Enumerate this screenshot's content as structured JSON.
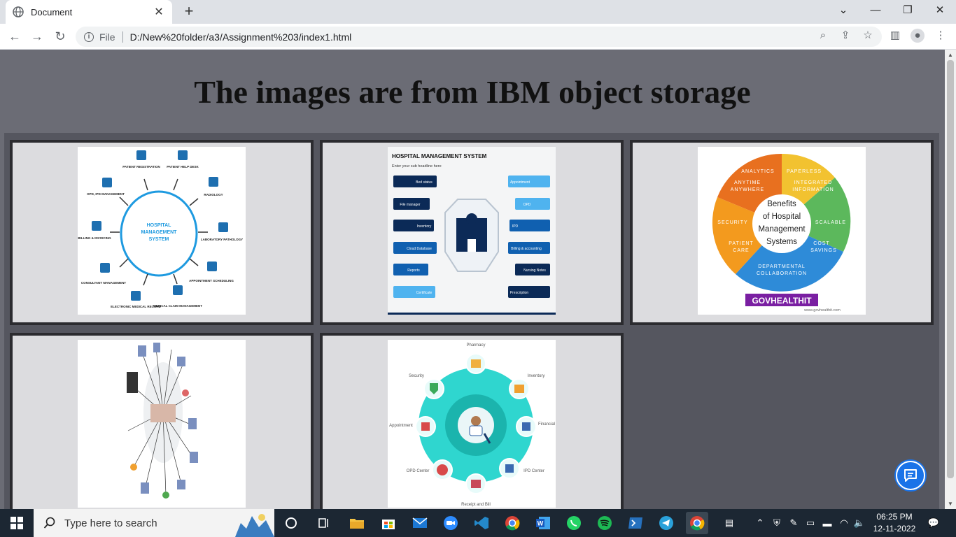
{
  "browser": {
    "tab_title": "Document",
    "tab_close": "✕",
    "new_tab": "+",
    "scheme_label": "File",
    "url": "D:/New%20folder/a3/Assignment%203/index1.html"
  },
  "page": {
    "heading": "The images are from IBM object storage"
  },
  "images": {
    "img1": {
      "center": [
        "HOSPITAL",
        "MANAGEMENT",
        "SYSTEM"
      ],
      "labels": [
        "PATIENT REGISTRATION",
        "PATIENT HELP DESK",
        "RADIOLOGY",
        "LABORATORY PATHOLOGY",
        "APPOINTMENT SCHEDULING",
        "MEDICAL CLAIM MANAGEMENT",
        "ELECTRONIC MEDICAL RECORD",
        "CONSULTANT MANAGEMENT",
        "BILLING & INVOICING",
        "OPD, IPD MANAGEMENT"
      ]
    },
    "img2": {
      "title": "HOSPITAL MANAGEMENT SYSTEM",
      "subtitle": "Enter your sub headline here",
      "left": [
        "Bed status",
        "File manager",
        "Inventory",
        "Cloud Database",
        "Reports",
        "Certificate"
      ],
      "right": [
        "Appointment",
        "OPD",
        "IPD",
        "Billing & accounting",
        "Nursing Notes",
        "Prescription"
      ]
    },
    "img3": {
      "center": [
        "Benefits",
        "of Hospital",
        "Management",
        "Systems"
      ],
      "segments": [
        "ANALYTICS",
        "PAPERLESS",
        "ANYTIME",
        "ANYWHERE",
        "INTEGRATED",
        "INFORMATION",
        "SECURITY",
        "SCALABLE",
        "PATIENT",
        "CARE",
        "COST",
        "SAVINGS",
        "DEPARTMENTAL",
        "COLLABORATION"
      ],
      "brand": "GOVHEALTHIT",
      "site": "www.govhealthit.com"
    },
    "img5": {
      "labels": [
        "Pharmacy",
        "Inventory",
        "Financial",
        "IPD Center",
        "Receipt and Bill",
        "OPD Center",
        "Appointment",
        "Security"
      ]
    }
  },
  "taskbar": {
    "search_placeholder": "Type here to search",
    "time": "06:25 PM",
    "date": "12-11-2022"
  },
  "colors": {
    "page_bg": "#6b6c75",
    "card_bg": "#dcdcdf",
    "accent": "#1a73e8"
  }
}
